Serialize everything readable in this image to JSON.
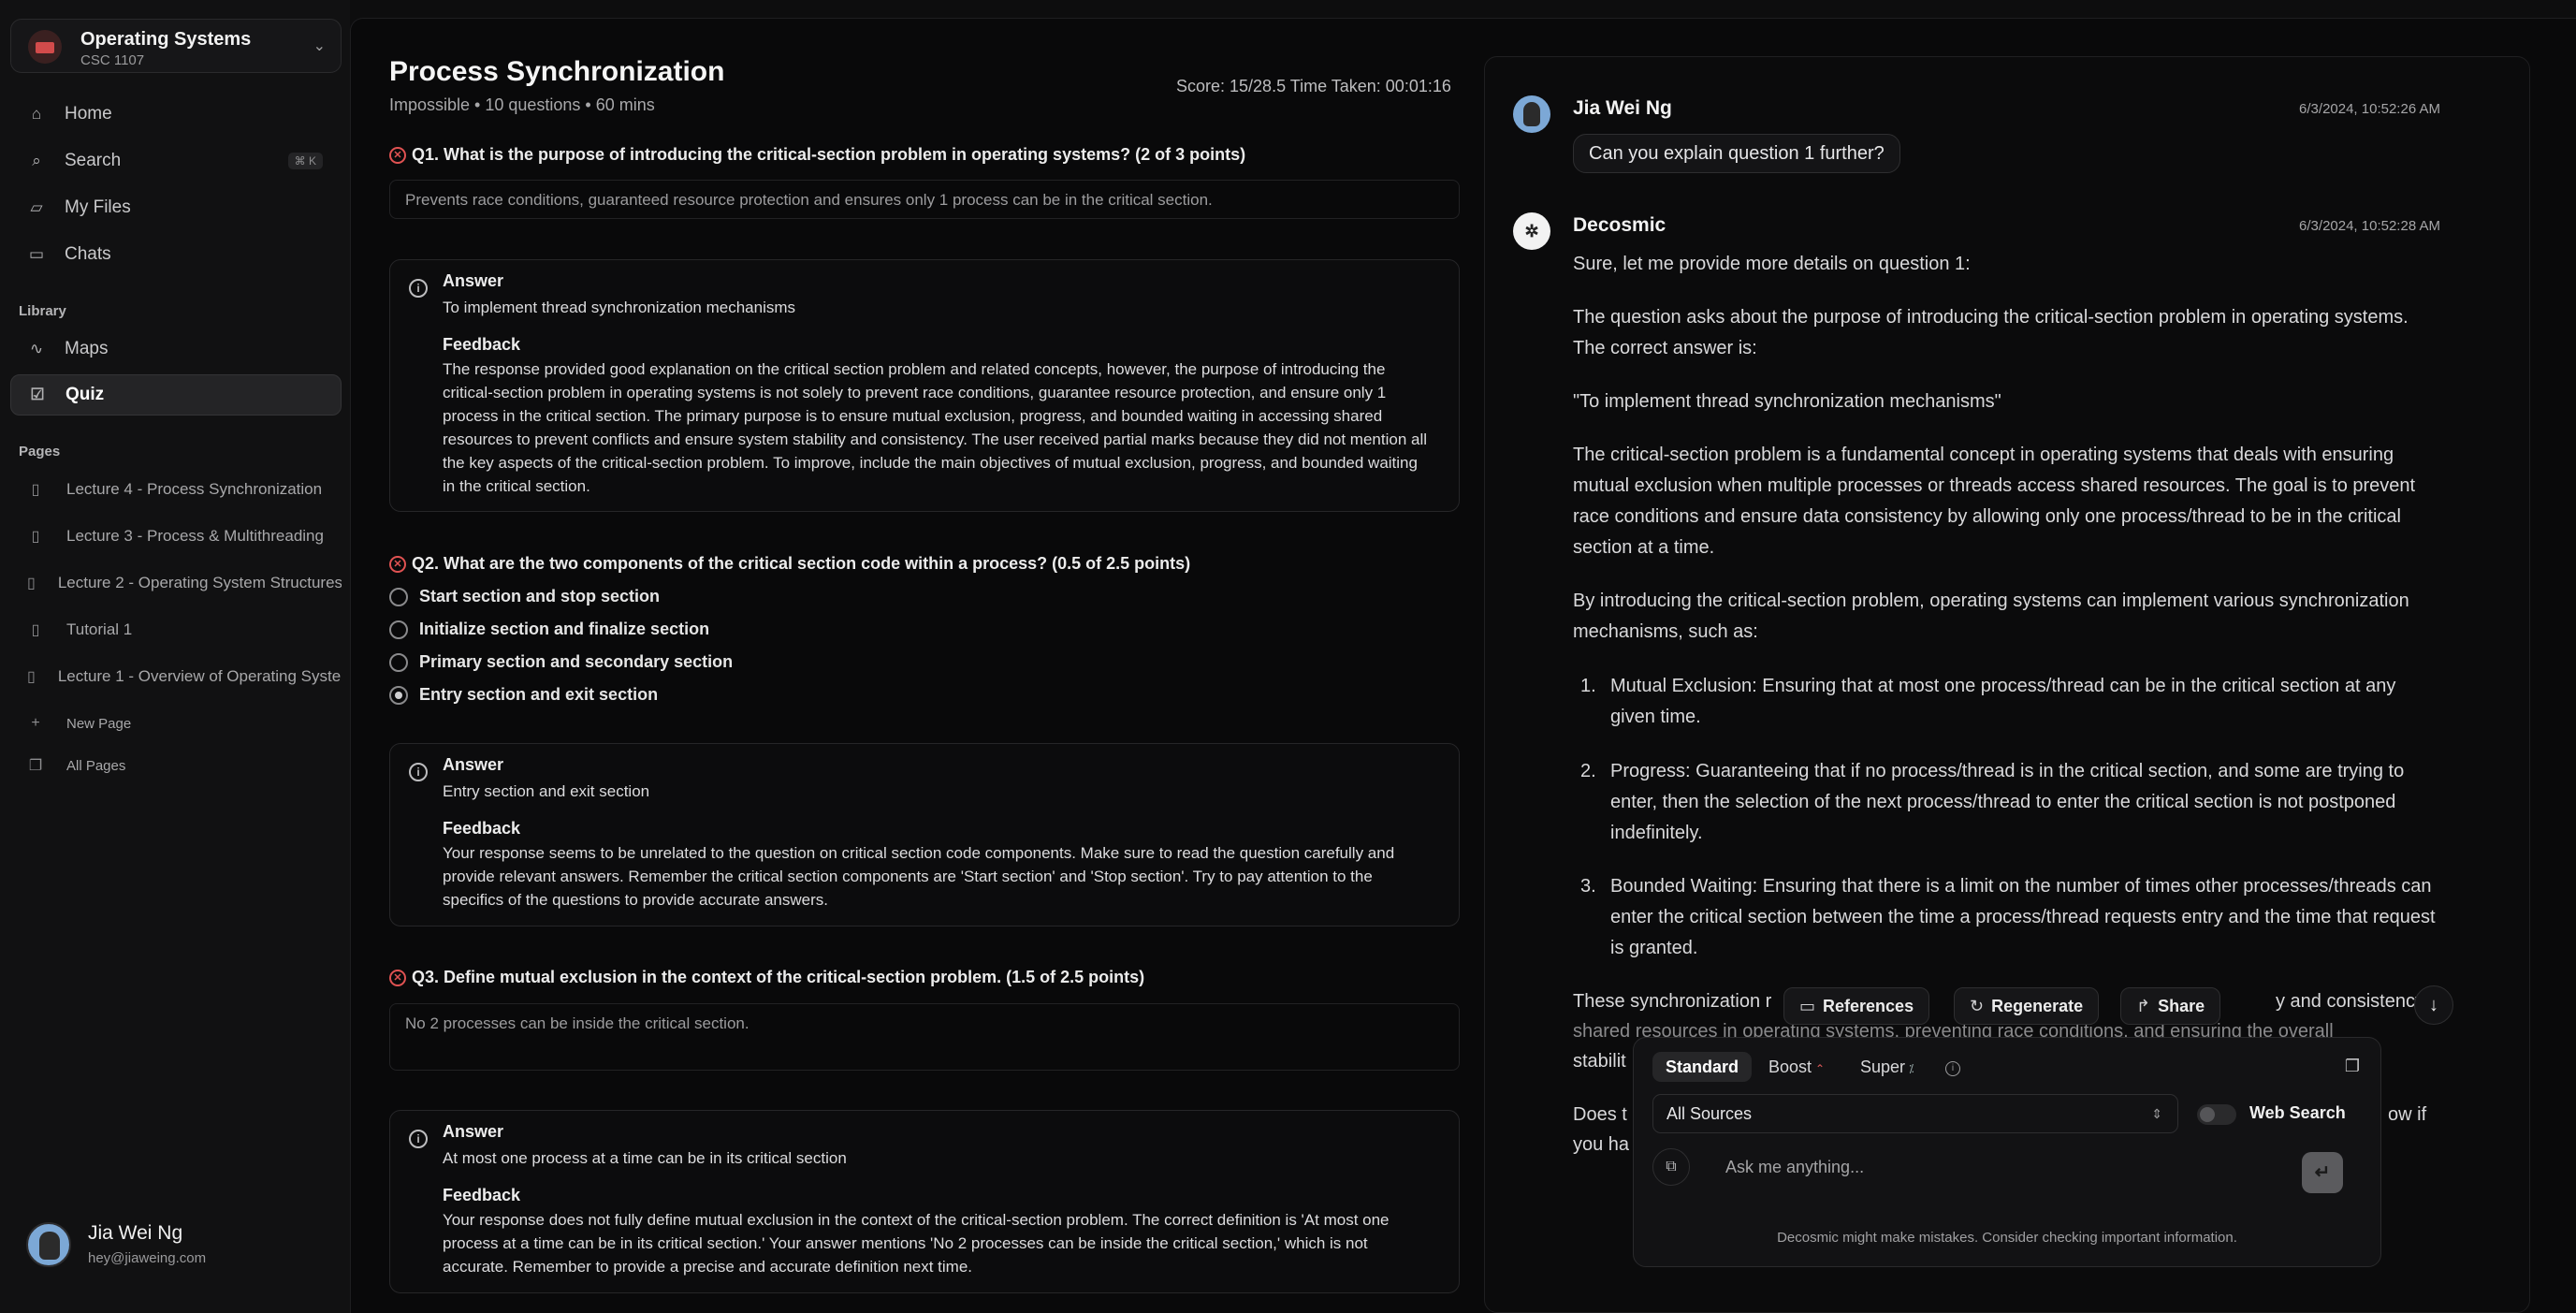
{
  "sidebar": {
    "workspace": {
      "title": "Operating Systems",
      "subtitle": "CSC 1107"
    },
    "nav": [
      {
        "label": "Home",
        "icon": "home-icon"
      },
      {
        "label": "Search",
        "icon": "search-icon",
        "shortcut": "⌘ K"
      },
      {
        "label": "My Files",
        "icon": "files-icon"
      },
      {
        "label": "Chats",
        "icon": "chats-icon"
      }
    ],
    "library_label": "Library",
    "library": [
      {
        "label": "Maps",
        "icon": "maps-icon"
      },
      {
        "label": "Quiz",
        "icon": "quiz-icon",
        "active": true
      }
    ],
    "pages_label": "Pages",
    "pages": [
      "Lecture 4 - Process Synchronization",
      "Lecture 3 - Process & Multithreading",
      "Lecture 2 - Operating System Structures",
      "Tutorial 1",
      "Lecture 1 - Overview of Operating Systems"
    ],
    "new_page": "New Page",
    "all_pages": "All Pages",
    "user": {
      "name": "Jia Wei Ng",
      "email": "hey@jiaweing.com"
    }
  },
  "quiz": {
    "title": "Process Synchronization",
    "meta": "Impossible • 10 questions • 60 mins",
    "score": "Score: 15/28.5  Time Taken: 00:01:16",
    "q1": {
      "question": "Q1. What is the purpose of introducing the critical-section problem in operating systems? (2 of 3 points)",
      "user_answer": "Prevents race conditions, guaranteed resource protection and ensures only 1 process can be in the critical section.",
      "answer_label": "Answer",
      "answer": "To implement thread synchronization mechanisms",
      "feedback_label": "Feedback",
      "feedback": "The response provided good explanation on the critical section problem and related concepts, however, the purpose of introducing the critical-section problem in operating systems is not solely to prevent race conditions, guarantee resource protection, and ensure only 1 process in the critical section. The primary purpose is to ensure mutual exclusion, progress, and bounded waiting in accessing shared resources to prevent conflicts and ensure system stability and consistency. The user received partial marks because they did not mention all the key aspects of the critical-section problem. To improve, include the main objectives of mutual exclusion, progress, and bounded waiting in the critical section."
    },
    "q2": {
      "question": "Q2. What are the two components of the critical section code within a process? (0.5 of 2.5 points)",
      "options": [
        "Start section and stop section",
        "Initialize section and finalize section",
        "Primary section and secondary section",
        "Entry section and exit section"
      ],
      "selected_index": 3,
      "answer_label": "Answer",
      "answer": "Entry section and exit section",
      "feedback_label": "Feedback",
      "feedback": "Your response seems to be unrelated to the question on critical section code components. Make sure to read the question carefully and provide relevant answers. Remember the critical section components are 'Start section' and 'Stop section'. Try to pay attention to the specifics of the questions to provide accurate answers."
    },
    "q3": {
      "question": "Q3. Define mutual exclusion in the context of the critical-section problem. (1.5 of 2.5 points)",
      "user_answer": "No 2 processes can be inside the critical section.",
      "answer_label": "Answer",
      "answer": "At most one process at a time can be in its critical section",
      "feedback_label": "Feedback",
      "feedback": "Your response does not fully define mutual exclusion in the context of the critical-section problem. The correct definition is 'At most one process at a time can be in its critical section.' Your answer mentions 'No 2 processes can be inside the critical section,' which is not accurate. Remember to provide a precise and accurate definition next time."
    }
  },
  "chat": {
    "user_msg": {
      "name": "Jia Wei Ng",
      "time": "6/3/2024, 10:52:26 AM",
      "text": "Can you explain question 1 further?"
    },
    "bot_msg": {
      "name": "Decosmic",
      "time": "6/3/2024, 10:52:28 AM",
      "p1": "Sure, let me provide more details on question 1:",
      "p2": "The question asks about the purpose of introducing the critical-section problem in operating systems. The correct answer is:",
      "p3": "\"To implement thread synchronization mechanisms\"",
      "p4": "The critical-section problem is a fundamental concept in operating systems that deals with ensuring mutual exclusion when multiple processes or threads access shared resources. The goal is to prevent race conditions and ensure data consistency by allowing only one process/thread to be in the critical section at a time.",
      "p5": "By introducing the critical-section problem, operating systems can implement various synchronization mechanisms, such as:",
      "list": [
        "Mutual Exclusion: Ensuring that at most one process/thread can be in the critical section at any given time.",
        "Progress: Guaranteeing that if no process/thread is in the critical section, and some are trying to enter, then the selection of the next process/thread to enter the critical section is not postponed indefinitely.",
        "Bounded Waiting: Ensuring that there is a limit on the number of times other processes/threads can enter the critical section between the time a process/thread requests entry and the time that request is granted."
      ],
      "p6_partial_left": "These synchronization r",
      "p6_partial_right": "y and consistency of",
      "p6_line2": "shared resources in operating systems, preventing race conditions, and ensuring the overall",
      "p6_line3": "stabilit",
      "p7_left": "Does t",
      "p7_right": "ow if",
      "p7_line2": "you ha"
    },
    "actions": {
      "references": "References",
      "regenerate": "Regenerate",
      "share": "Share"
    },
    "composer": {
      "modes": [
        "Standard",
        "Boost",
        "Super"
      ],
      "source": "All Sources",
      "web_search": "Web Search",
      "placeholder": "Ask me anything...",
      "disclaimer": "Decosmic might make mistakes. Consider checking important information."
    }
  }
}
